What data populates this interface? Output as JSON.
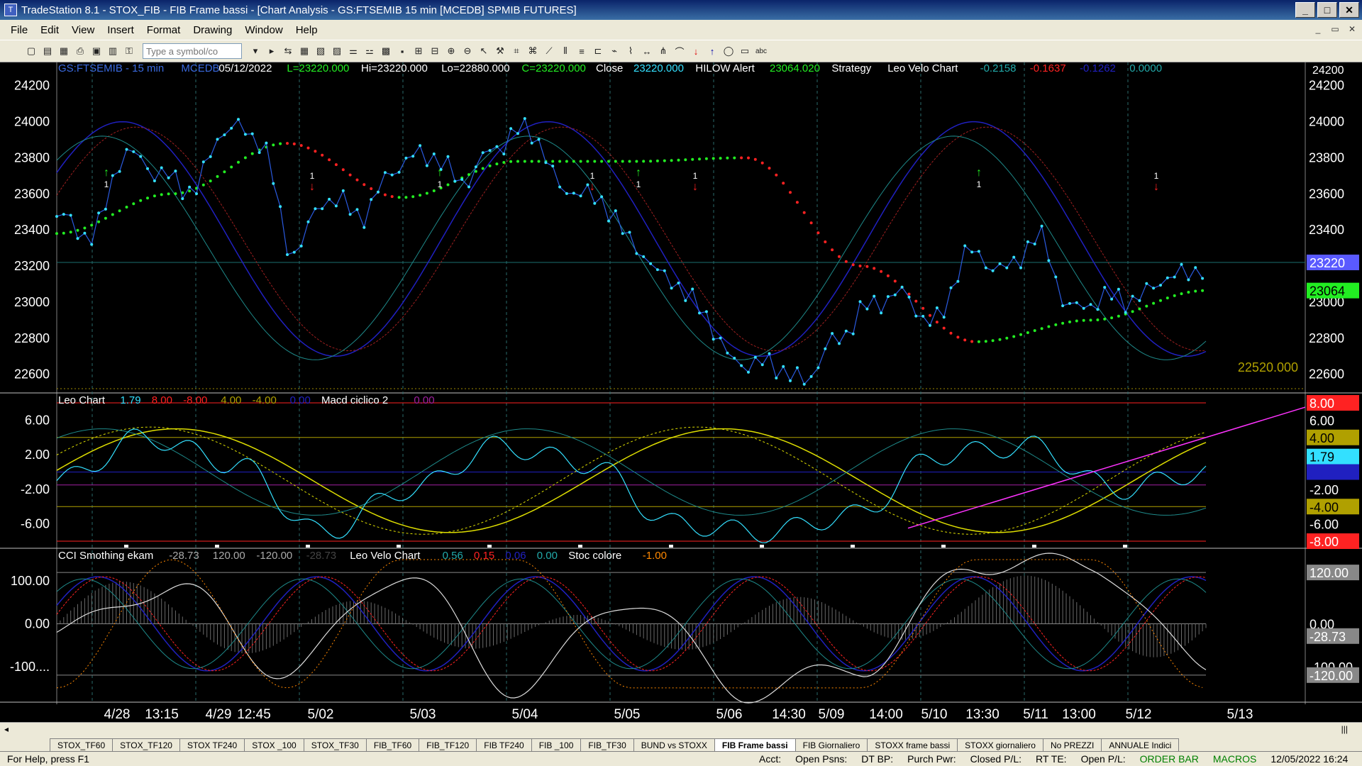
{
  "window": {
    "title": "TradeStation 8.1 - STOX_FIB - FIB Frame bassi - [Chart Analysis - GS:FTSEMIB  15 min  [MCEDB] SPMIB FUTURES]"
  },
  "menu": [
    "File",
    "Edit",
    "View",
    "Insert",
    "Format",
    "Drawing",
    "Window",
    "Help"
  ],
  "toolbar": {
    "symbol_placeholder": "Type a symbol/co"
  },
  "colors": {
    "bg": "#000000",
    "price": "#33e0ff",
    "green": "#22ee22",
    "red": "#ff2222",
    "yellow": "#dddd00",
    "magenta": "#ff33ff",
    "navy": "#2020c0",
    "darkred": "#a02020",
    "teal": "#22aaaa",
    "olive": "#b0a000"
  },
  "icons": [
    "new-icon",
    "open-icon",
    "save-icon",
    "print-icon",
    "zoom-in-icon",
    "zoom-out-icon",
    "pointer-icon",
    "trendline-icon",
    "arrow-up-icon",
    "arrow-down-icon",
    "ellipse-icon",
    "rectangle-icon",
    "text-icon"
  ],
  "panel1": {
    "header": [
      {
        "t": "GS:FTSEMIB - 15 min",
        "c": "#3a6adf"
      },
      {
        "t": "MCEDB",
        "c": "#3a6adf"
      },
      {
        "t": "05/12/2022",
        "c": "#ffffff"
      },
      {
        "t": "L=23220.000",
        "c": "#22ee22"
      },
      {
        "t": "Hi=23220.000",
        "c": "#ffffff"
      },
      {
        "t": "Lo=22880.000",
        "c": "#ffffff"
      },
      {
        "t": "C=23220.000",
        "c": "#22ee22"
      },
      {
        "t": "Close",
        "c": "#ffffff"
      },
      {
        "t": "23220.000",
        "c": "#33e0ff"
      },
      {
        "t": "HILOW Alert",
        "c": "#ffffff"
      },
      {
        "t": "23064.020",
        "c": "#22ee22"
      },
      {
        "t": "Strategy",
        "c": "#ffffff"
      },
      {
        "t": "Leo Velo Chart",
        "c": "#ffffff"
      },
      {
        "t": "-0.2158",
        "c": "#22aaaa"
      },
      {
        "t": "-0.1637",
        "c": "#ff2222"
      },
      {
        "t": "-0.1262",
        "c": "#2020c0"
      },
      {
        "t": "0.0000",
        "c": "#22aaaa"
      }
    ],
    "yticks": [
      "24200",
      "24000",
      "23800",
      "23600",
      "23400",
      "23200",
      "23000",
      "22800",
      "22600"
    ],
    "badges": [
      {
        "t": "23220",
        "bg": "#5a5aff",
        "fg": "#ffffff"
      },
      {
        "t": "23064",
        "bg": "#22ee22",
        "fg": "#000000"
      }
    ],
    "level_label": "22520.000"
  },
  "panel2": {
    "header": [
      {
        "t": "Leo Chart",
        "c": "#ffffff"
      },
      {
        "t": "1.79",
        "c": "#33e0ff"
      },
      {
        "t": "8.00",
        "c": "#ff2222"
      },
      {
        "t": "-8.00",
        "c": "#ff2222"
      },
      {
        "t": "4.00",
        "c": "#b0a000"
      },
      {
        "t": "-4.00",
        "c": "#b0a000"
      },
      {
        "t": "0.00",
        "c": "#2020c0"
      },
      {
        "t": "Macd ciclico 2",
        "c": "#ffffff"
      },
      {
        "t": "0.00",
        "c": "#a020a0"
      }
    ],
    "yticks": [
      "6.00",
      "2.00",
      "-2.00",
      "-6.00"
    ],
    "badges": [
      {
        "t": "8.00",
        "bg": "#ff2222",
        "fg": "#ffffff"
      },
      {
        "t": "6.00",
        "bg": "#000000",
        "fg": "#ffffff"
      },
      {
        "t": "4.00",
        "bg": "#b0a000",
        "fg": "#000000"
      },
      {
        "t": "1.79",
        "bg": "#33e0ff",
        "fg": "#000000"
      },
      {
        "t": "0.00",
        "bg": "#2020c0",
        "fg": "#2020c0"
      },
      {
        "t": "-2.00",
        "bg": "#000000",
        "fg": "#ffffff"
      },
      {
        "t": "-4.00",
        "bg": "#b0a000",
        "fg": "#000000"
      },
      {
        "t": "-6.00",
        "bg": "#000000",
        "fg": "#ffffff"
      },
      {
        "t": "-8.00",
        "bg": "#ff2222",
        "fg": "#ffffff"
      }
    ]
  },
  "panel3": {
    "header": [
      {
        "t": "CCI Smothing ekam",
        "c": "#ffffff"
      },
      {
        "t": "-28.73",
        "c": "#aaaaaa"
      },
      {
        "t": "120.00",
        "c": "#aaaaaa"
      },
      {
        "t": "-120.00",
        "c": "#aaaaaa"
      },
      {
        "t": "-28.73",
        "c": "#444444"
      },
      {
        "t": "Leo Velo Chart",
        "c": "#ffffff"
      },
      {
        "t": "0.56",
        "c": "#22aaaa"
      },
      {
        "t": "0.15",
        "c": "#ff2222"
      },
      {
        "t": "0.06",
        "c": "#2020c0"
      },
      {
        "t": "0.00",
        "c": "#22aaaa"
      },
      {
        "t": "Stoc colore",
        "c": "#ffffff"
      },
      {
        "t": "-1.00",
        "c": "#ff8800"
      }
    ],
    "yticks": [
      "100.00",
      "0.00",
      "-100...."
    ],
    "badges": [
      {
        "t": "120.00",
        "bg": "#888888",
        "fg": "#ffffff"
      },
      {
        "t": "0.00",
        "bg": "#000000",
        "fg": "#ffffff"
      },
      {
        "t": "-28.73",
        "bg": "#888888",
        "fg": "#ffffff"
      },
      {
        "t": "-100.00",
        "bg": "#000000",
        "fg": "#ffffff"
      },
      {
        "t": "-120.00",
        "bg": "#888888",
        "fg": "#ffffff"
      }
    ]
  },
  "xaxis": [
    "4/28",
    "13:15",
    "4/29",
    "12:45",
    "5/02",
    "5/03",
    "5/04",
    "5/05",
    "5/06",
    "14:30",
    "5/09",
    "14:00",
    "5/10",
    "13:30",
    "5/11",
    "13:00",
    "5/12",
    "5/13"
  ],
  "chart_data": {
    "type": "line",
    "title": "GS:FTSEMIB - 15 min",
    "x": [
      "4/28",
      "4/29",
      "5/02",
      "5/03",
      "5/04",
      "5/05",
      "5/06",
      "5/09",
      "5/10",
      "5/11",
      "5/12"
    ],
    "series": [
      {
        "name": "Close",
        "values": [
          23800,
          23950,
          23300,
          23750,
          23850,
          23950,
          23400,
          22700,
          22750,
          23200,
          23220
        ]
      },
      {
        "name": "HILOW Alert",
        "values": [
          23380,
          23600,
          23880,
          23580,
          23780,
          23780,
          23800,
          23200,
          22780,
          22900,
          23064
        ]
      }
    ],
    "ylim": [
      22520,
      24250
    ],
    "osc": {
      "name": "Leo Chart",
      "ylim": [
        -8,
        8
      ]
    },
    "cci": {
      "name": "CCI Smothing ekam",
      "ylim": [
        -180,
        160
      ]
    }
  },
  "tabs": [
    "STOX_TF60",
    "STOX_TF120",
    "STOX TF240",
    "STOX _100",
    "STOX_TF30",
    "FIB_TF60",
    "FIB_TF120",
    "FIB TF240",
    "FIB _100",
    "FIB_TF30",
    "BUND vs STOXX",
    "FIB Frame bassi",
    "FIB Giornaliero",
    "STOXX frame bassi",
    "STOXX giornaliero",
    "No PREZZI",
    "ANNUALE Indici"
  ],
  "active_tab": "FIB Frame bassi",
  "status": [
    "For Help, press F1",
    "Acct:",
    "Open Psns:",
    "DT BP:",
    "Purch Pwr:",
    "Closed P/L:",
    "RT TE:",
    "Open P/L:",
    "ORDER BAR",
    "MACROS",
    "12/05/2022 16:24"
  ]
}
